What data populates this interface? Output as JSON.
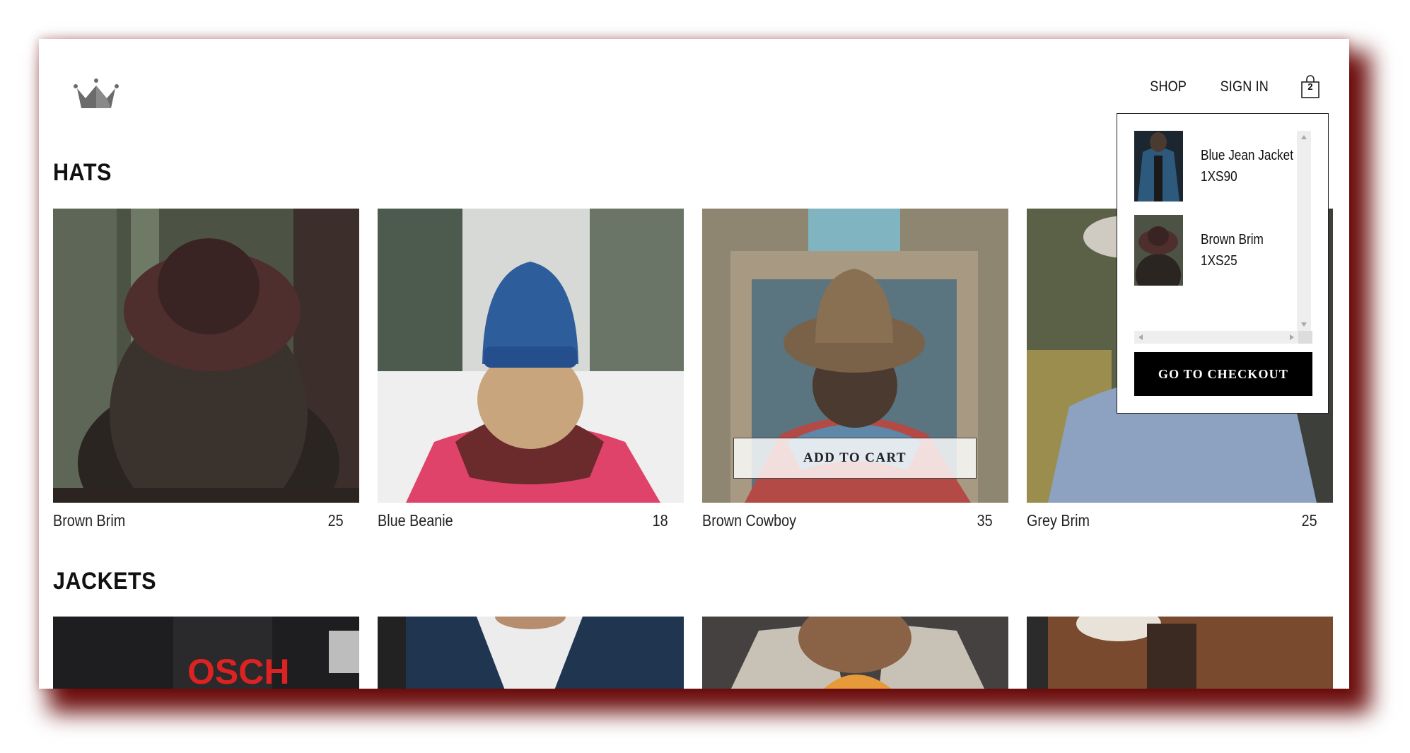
{
  "header": {
    "logo_icon": "crown-logo-icon",
    "nav": {
      "shop": "SHOP",
      "sign_in": "SIGN IN"
    },
    "cart_icon": "shopping-bag-icon",
    "cart_count": "2"
  },
  "sections": [
    {
      "title": "HATS",
      "items": [
        {
          "name": "Brown Brim",
          "price": "25"
        },
        {
          "name": "Blue Beanie",
          "price": "18"
        },
        {
          "name": "Brown Cowboy",
          "price": "35",
          "button": "ADD TO CART"
        },
        {
          "name": "Grey Brim",
          "price": "25"
        }
      ]
    },
    {
      "title": "JACKETS",
      "items": [
        {
          "name": "",
          "price": ""
        },
        {
          "name": "",
          "price": ""
        },
        {
          "name": "",
          "price": ""
        },
        {
          "name": "",
          "price": ""
        }
      ]
    }
  ],
  "cart_dropdown": {
    "items": [
      {
        "name": "Blue Jean Jacket",
        "detail": "1XS90"
      },
      {
        "name": "Brown Brim",
        "detail": "1XS25"
      }
    ],
    "checkout_label": "GO TO CHECKOUT"
  }
}
